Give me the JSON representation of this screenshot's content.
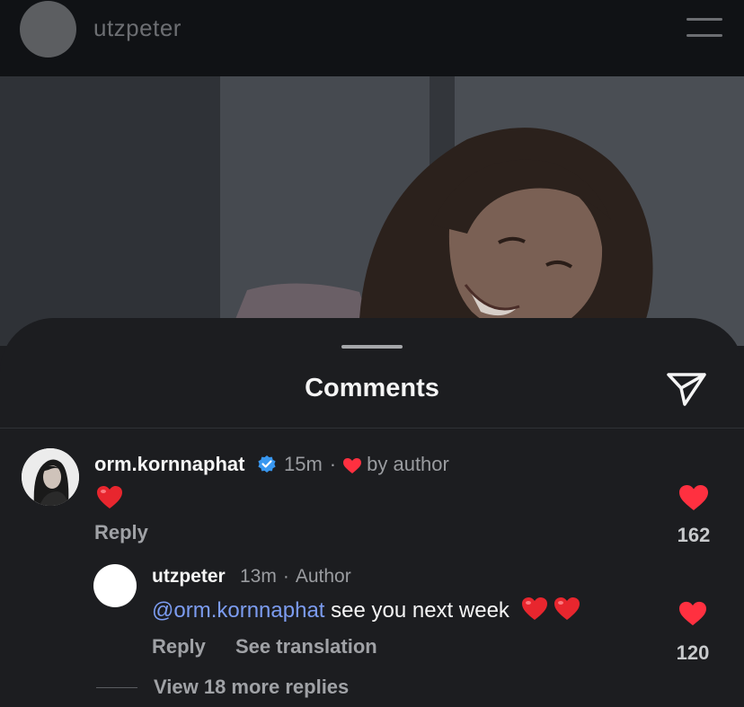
{
  "header": {
    "username": "utzpeter",
    "menu_icon": "hamburger-icon"
  },
  "sheet": {
    "title": "Comments",
    "share_icon": "send-icon"
  },
  "comments": [
    {
      "username": "orm.kornnaphat",
      "verified": true,
      "time": "15m",
      "separator": "·",
      "liked_by_author_label": "by author",
      "text_emoji": "heart-emoji",
      "reply_label": "Reply",
      "like_count": "162",
      "liked": true,
      "colors": {
        "like": "#ff3040",
        "verified": "#3897f0"
      }
    }
  ],
  "replies": [
    {
      "username": "utzpeter",
      "time": "13m",
      "separator": "·",
      "badge": "Author",
      "mention": "@orm.kornnaphat",
      "text": " see you next week",
      "reply_label": "Reply",
      "translate_label": "See translation",
      "like_count": "120",
      "liked": true
    }
  ],
  "view_more_label": "View 18 more replies"
}
